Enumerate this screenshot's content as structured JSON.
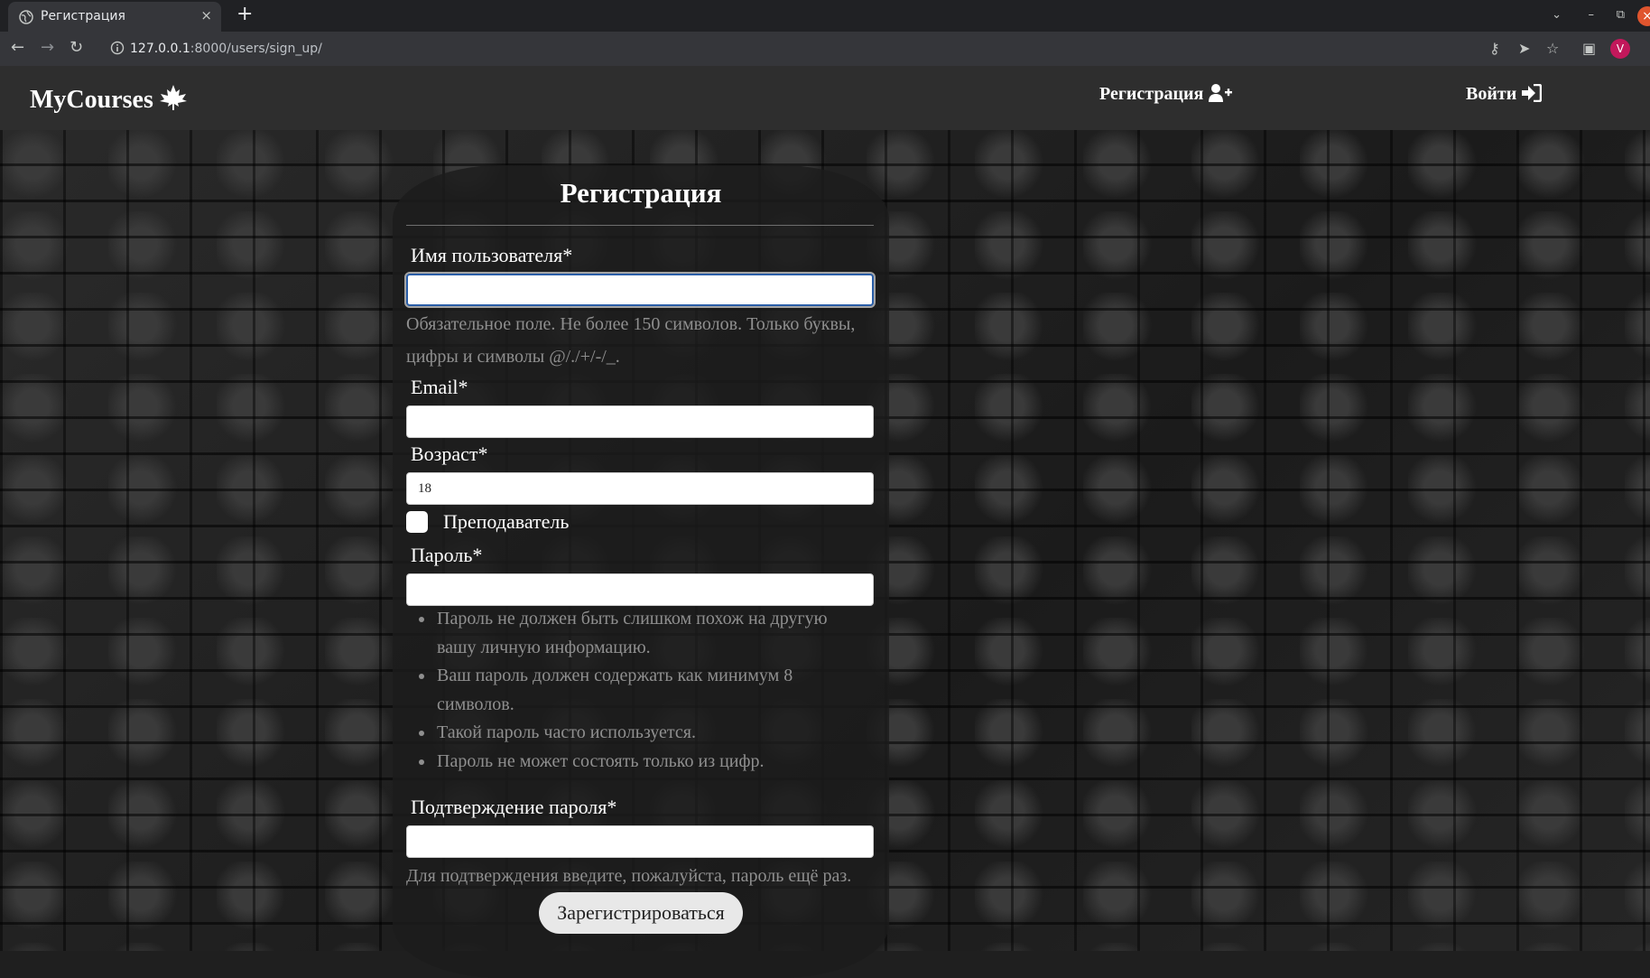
{
  "browser": {
    "tab_title": "Регистрация",
    "tab_close": "×",
    "new_tab": "+",
    "url_host": "127.0.0.1",
    "url_path": ":8000/users/sign_up/",
    "profile_initial": "V",
    "icons": [
      "back-icon",
      "forward-icon",
      "reload-icon",
      "info-icon",
      "key-icon",
      "send-icon",
      "star-icon",
      "sidepanel-icon",
      "chevron-down-icon",
      "minimize-icon",
      "restore-icon",
      "close-icon"
    ],
    "accent_profile": "#c2185b"
  },
  "nav": {
    "brand": "MyCourses",
    "register_link": "Регистрация",
    "login_link": "Войти"
  },
  "form": {
    "title": "Регистрация",
    "username_label": "Имя пользователя*",
    "username_value": "",
    "username_help": "Обязательное поле. Не более 150 символов. Только буквы, цифры и символы @/./+/-/_.",
    "email_label": "Email*",
    "email_value": "",
    "age_label": "Возраст*",
    "age_value": "18",
    "teacher_label": "Преподаватель",
    "teacher_checked": false,
    "password_label": "Пароль*",
    "password_value": "",
    "password_help": [
      "Пароль не должен быть слишком похож на другую вашу личную информацию.",
      "Ваш пароль должен содержать как минимум 8 символов.",
      "Такой пароль часто используется.",
      "Пароль не может состоять только из цифр."
    ],
    "password2_label": "Подтверждение пароля*",
    "password2_value": "",
    "password2_help": "Для подтверждения введите, пожалуйста, пароль ещё раз.",
    "submit_label": "Зарегистрироваться"
  }
}
